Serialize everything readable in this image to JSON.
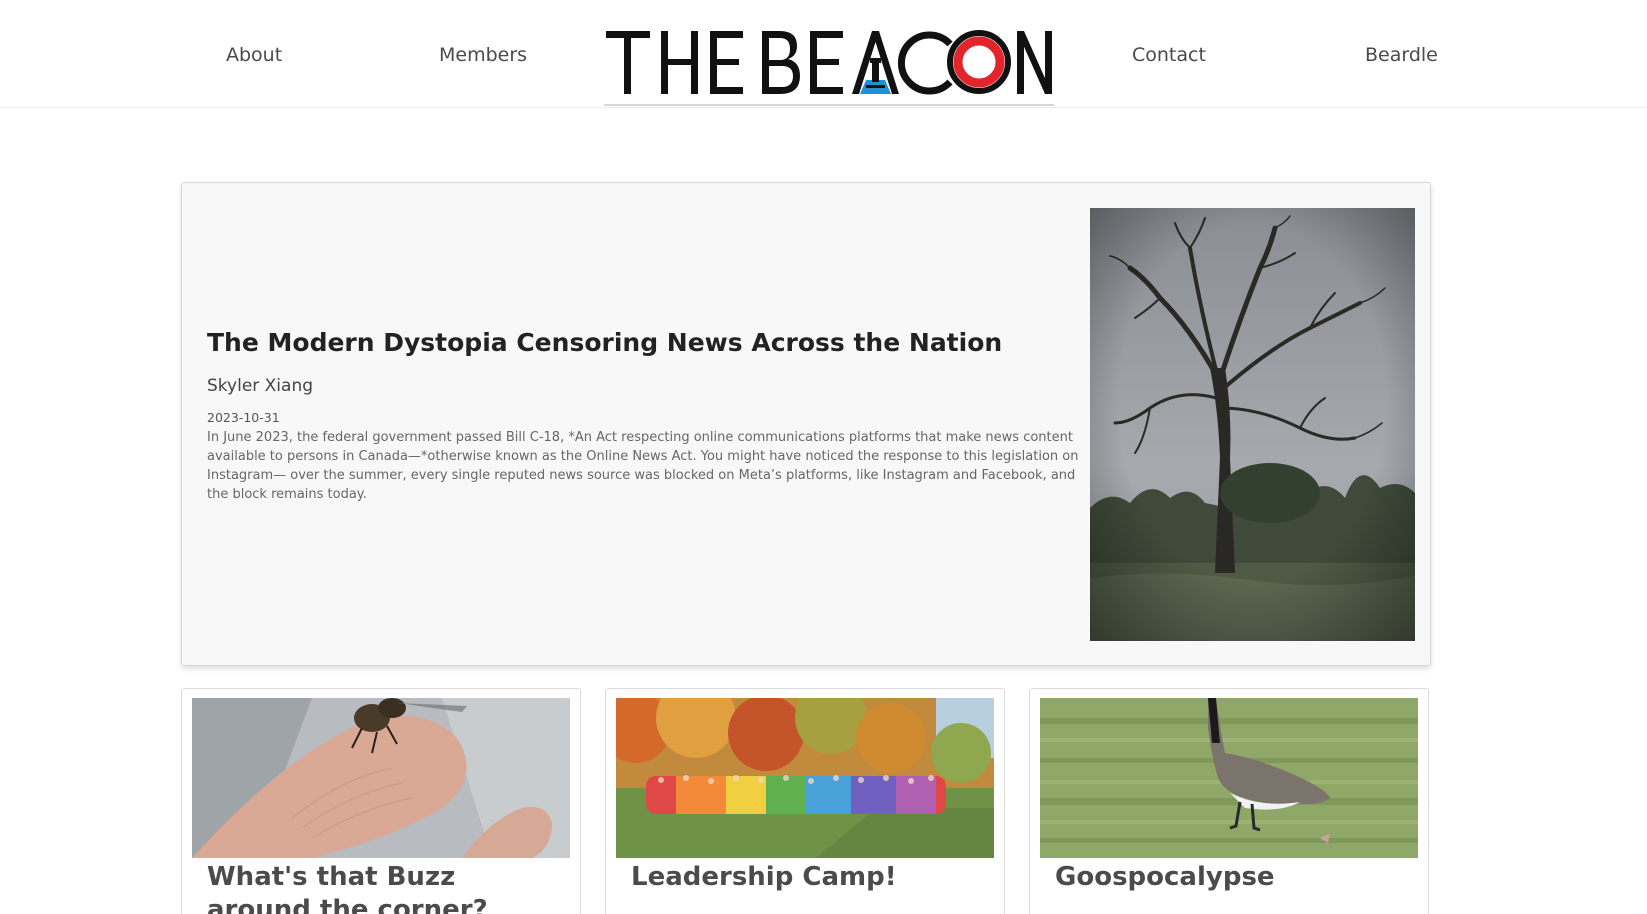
{
  "nav": {
    "about": "About",
    "members": "Members",
    "contact": "Contact",
    "beardle": "Beardle"
  },
  "logo": {
    "text_left": "THE BE",
    "text_right": "C",
    "text_end": "N",
    "alt_text": "THE BEACON"
  },
  "colors": {
    "accent": "#e3242b",
    "logo_black": "#111111",
    "lighthouse_blue": "#1e90d6"
  },
  "featured": {
    "title": "The Modern Dystopia Censoring News Across the Nation",
    "author": "Skyler Xiang",
    "date": "2023-10-31",
    "excerpt": "In June 2023, the federal government passed Bill C-18, *An Act respecting online communications platforms that make news content available to persons in Canada—*otherwise known as the Online News Act. You might have noticed the response to this legislation on Instagram— over the summer, every single reputed news source was blocked on Meta’s platforms, like Instagram and Facebook, and the block remains today.",
    "image_icon": "bare-tree-photo"
  },
  "cards": [
    {
      "title": "What's that Buzz around the corner?",
      "author": "",
      "image_icon": "fly-on-finger-photo"
    },
    {
      "title": "Leadership Camp!",
      "author": "",
      "image_icon": "group-photo-autumn"
    },
    {
      "title": "Goospocalypse",
      "author": "",
      "image_icon": "goose-photo"
    }
  ]
}
